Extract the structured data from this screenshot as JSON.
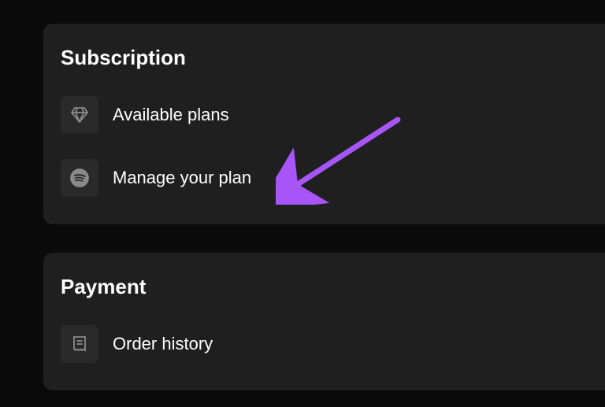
{
  "subscription": {
    "title": "Subscription",
    "items": [
      {
        "label": "Available plans"
      },
      {
        "label": "Manage your plan"
      }
    ]
  },
  "payment": {
    "title": "Payment",
    "items": [
      {
        "label": "Order history"
      }
    ]
  },
  "annotation": {
    "arrow_color": "#a855f7"
  }
}
